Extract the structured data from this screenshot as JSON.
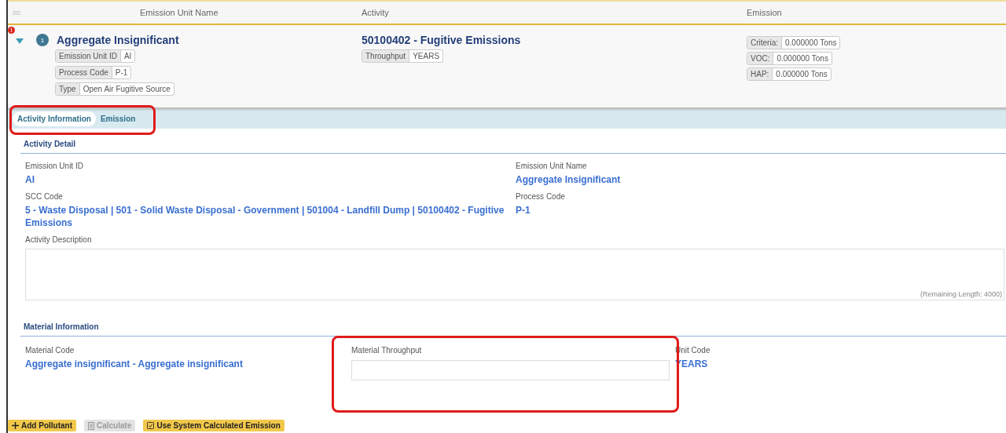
{
  "grid_header": {
    "columns": [
      "Emission Unit Name",
      "Activity",
      "Emission"
    ]
  },
  "unit_row": {
    "error_badge": "!",
    "expanded": true,
    "number": "1",
    "name": "Aggregate Insignificant",
    "tags": [
      {
        "label": "Emission Unit ID",
        "value": "AI"
      },
      {
        "label": "Process Code",
        "value": "P-1"
      },
      {
        "label": "Type",
        "value": "Open Air Fugitive Source"
      }
    ],
    "activity": "50100402 - Fugitive Emissions",
    "activity_tags": [
      {
        "label": "Throughput",
        "value": "YEARS"
      }
    ],
    "emissions": [
      {
        "label": "Criteria:",
        "value": "0.000000 Tons"
      },
      {
        "label": "VOC:",
        "value": "0.000000 Tons"
      },
      {
        "label": "HAP:",
        "value": "0.000000 Tons"
      }
    ]
  },
  "tabs": [
    {
      "label": "Activity Information",
      "selected": true
    },
    {
      "label": "Emission",
      "selected": false
    }
  ],
  "activity_detail": {
    "title": "Activity Detail",
    "fields": [
      {
        "label": "Emission Unit ID",
        "value": "AI"
      },
      {
        "label": "Emission Unit Name",
        "value": "Aggregate Insignificant"
      },
      {
        "label": "SCC Code",
        "value": "5 - Waste Disposal | 501 - Solid Waste Disposal - Government | 501004 - Landfill Dump | 50100402 - Fugitive Emissions"
      },
      {
        "label": "Process Code",
        "value": "P-1"
      }
    ],
    "description_label": "Activity Description",
    "remaining": "(Remaining Length: 4000)"
  },
  "material_information": {
    "title": "Material Information",
    "material_code_label": "Material Code",
    "material_code": "Aggregate insignificant - Aggregate insignificant",
    "throughput_label": "Material Throughput",
    "unit_code_label": "Unit Code",
    "unit_code": "YEARS"
  },
  "buttons": [
    {
      "label": "Add Pollutant",
      "kind": "add",
      "disabled": false
    },
    {
      "label": "Calculate",
      "kind": "calc",
      "disabled": true
    },
    {
      "label": "Use System Calculated Emission",
      "kind": "check",
      "disabled": false
    }
  ]
}
